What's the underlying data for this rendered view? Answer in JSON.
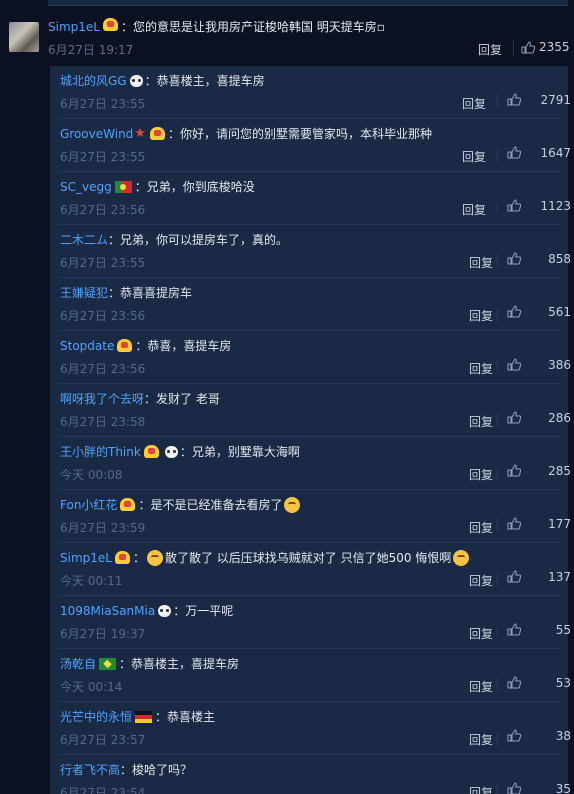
{
  "main_comment": {
    "user": "Simp1eL",
    "text": "：您的意思是让我用房产证梭哈韩国 明天提车房▫",
    "time": "6月27日 19:17",
    "reply_label": "回复",
    "likes": "2355"
  },
  "replies": [
    {
      "user": "城北的风GG",
      "badges": [
        "panda"
      ],
      "text": "：恭喜楼主，喜提车房",
      "time": "6月27日 23:55",
      "reply_label": "回复",
      "likes": "2791"
    },
    {
      "user": "GrooveWind",
      "badges": [
        "star",
        "vip"
      ],
      "text": "：你好，请问您的别墅需要管家吗，本科毕业那种",
      "time": "6月27日 23:55",
      "reply_label": "回复",
      "likes": "1647"
    },
    {
      "user": "SC_vegg",
      "badges": [
        "flag-pt"
      ],
      "text": "：兄弟，你到底梭哈没",
      "time": "6月27日 23:56",
      "reply_label": "回复",
      "likes": "1123"
    },
    {
      "user": "二木二ム",
      "badges": [],
      "text": "：兄弟，你可以提房车了，真的。",
      "time": "6月27日 23:55",
      "reply_label": "回复",
      "likes": "858"
    },
    {
      "user": "王嫌疑犯",
      "badges": [],
      "text": "：恭喜喜提房车",
      "time": "6月27日 23:56",
      "reply_label": "回复",
      "likes": "561"
    },
    {
      "user": "Stopdate",
      "badges": [
        "vip"
      ],
      "text": "：恭喜，喜提车房",
      "time": "6月27日 23:56",
      "reply_label": "回复",
      "likes": "386"
    },
    {
      "user": "啊呀我了个去呀",
      "badges": [],
      "text": "：发财了 老哥",
      "time": "6月27日 23:58",
      "reply_label": "回复",
      "likes": "286"
    },
    {
      "user": "王小胖的Think",
      "badges": [
        "vip",
        "panda"
      ],
      "text": "：兄弟，别墅靠大海啊",
      "time": "今天 00:08",
      "reply_label": "回复",
      "likes": "285"
    },
    {
      "user": "Fon小红花",
      "badges": [
        "vip"
      ],
      "text": "：是不是已经准备去看房了",
      "trailing_emoji": true,
      "time": "6月27日 23:59",
      "reply_label": "回复",
      "likes": "177"
    },
    {
      "user": "Simp1eL",
      "badges": [
        "vip"
      ],
      "text": "：",
      "text_after_emoji": "散了散了 以后压球找乌贼就对了 只信了她500 悔恨啊",
      "lead_emoji": true,
      "trailing_emoji": true,
      "time": "今天 00:11",
      "reply_label": "回复",
      "likes": "137"
    },
    {
      "user": "1098MiaSanMia",
      "badges": [
        "panda"
      ],
      "text": "：万一平呢",
      "time": "6月27日 19:37",
      "reply_label": "回复",
      "likes": "55"
    },
    {
      "user": "汤乾自",
      "badges": [
        "flag-br"
      ],
      "text": "：恭喜楼主，喜提车房",
      "time": "今天 00:14",
      "reply_label": "回复",
      "likes": "53"
    },
    {
      "user": "光芒中的永恒",
      "badges": [
        "flag-de"
      ],
      "text": "：恭喜楼主",
      "time": "6月27日 23:57",
      "reply_label": "回复",
      "likes": "38"
    },
    {
      "user": "行者飞不高",
      "badges": [],
      "text": "：梭哈了吗？",
      "time": "6月27日 23:54",
      "reply_label": "回复",
      "likes": "35"
    }
  ],
  "colors": {
    "username": "#4fa3ff",
    "background": "#0b1120",
    "reply_panel": "#1a2a44"
  }
}
